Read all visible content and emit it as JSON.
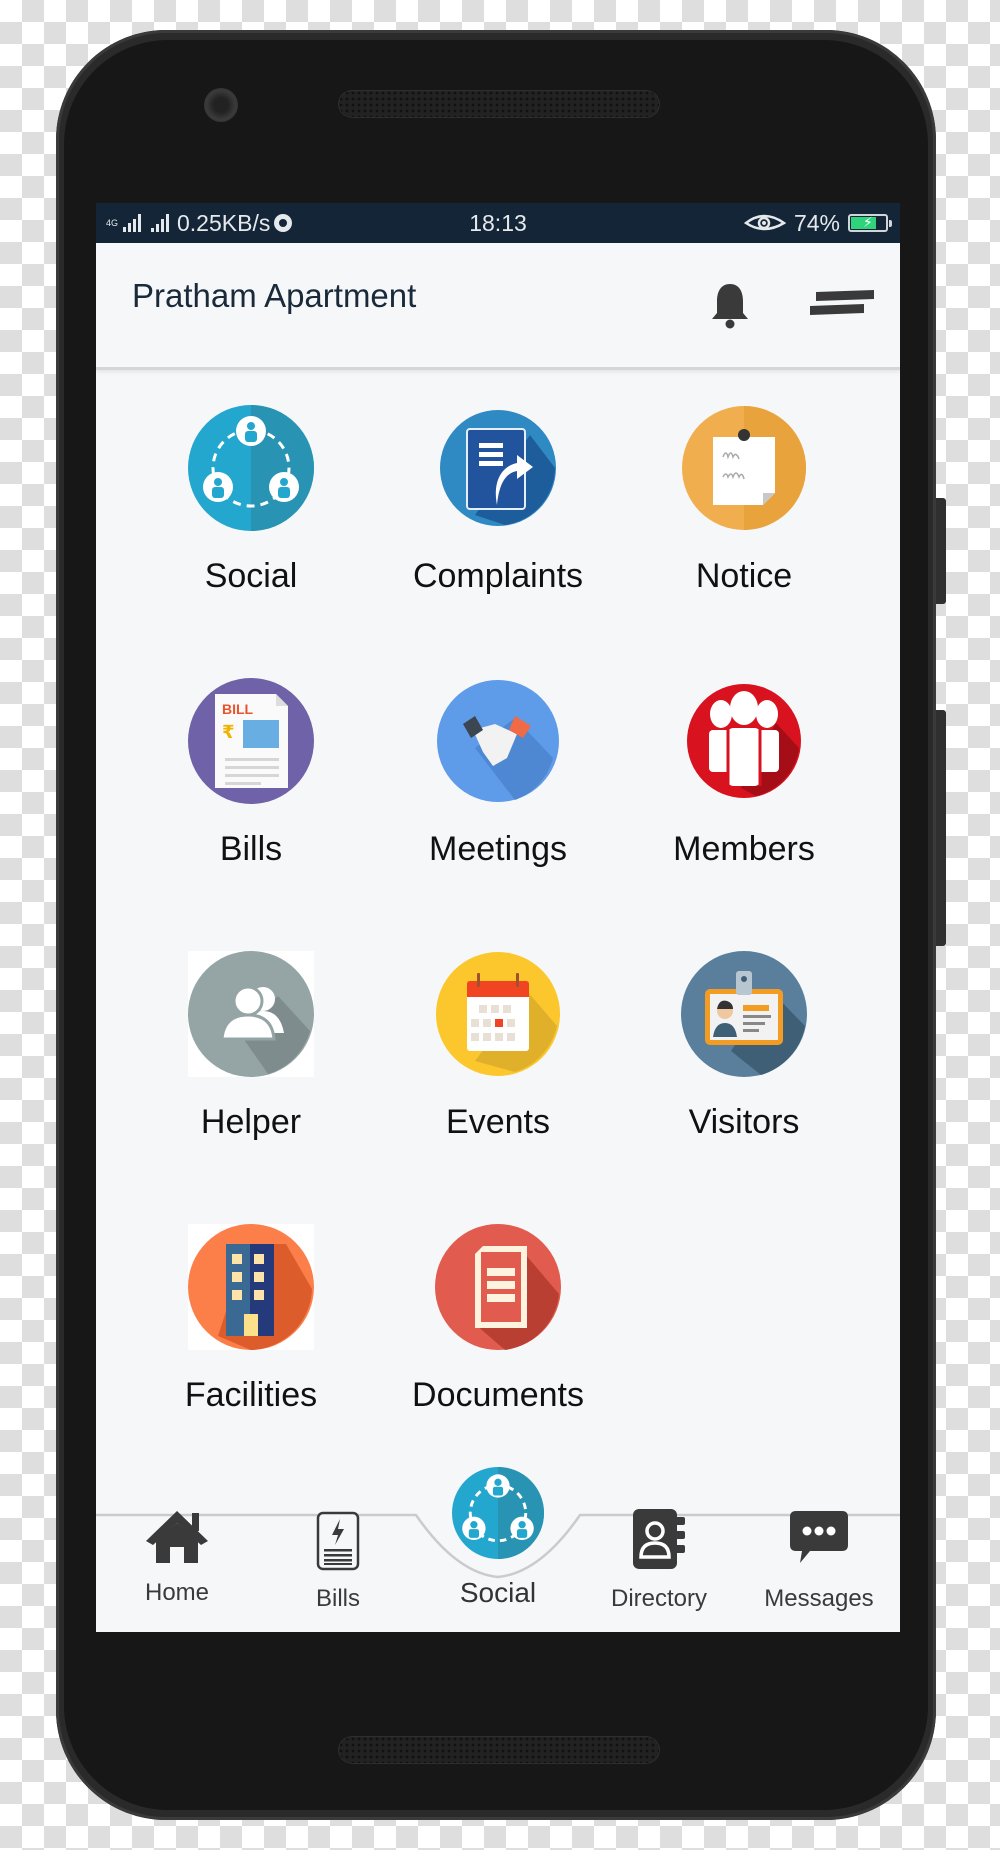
{
  "status_bar": {
    "network_type": "4G",
    "data_speed": "0.25KB/s",
    "time": "18:13",
    "battery_percent": "74%",
    "battery_level": 0.74,
    "icons": [
      "signal-icon",
      "signal-icon",
      "chrome-icon",
      "eye-icon",
      "battery-charging-icon"
    ]
  },
  "header": {
    "title": "Pratham Apartment",
    "icons": [
      "bell-icon",
      "menu-icon"
    ]
  },
  "grid": {
    "items": [
      {
        "label": "Social",
        "icon": "social-icon",
        "color": "#23a7cf"
      },
      {
        "label": "Complaints",
        "icon": "complaints-icon",
        "color": "#2f89c2"
      },
      {
        "label": "Notice",
        "icon": "notice-icon",
        "color": "#f0ad4e"
      },
      {
        "label": "Bills",
        "icon": "bills-icon",
        "color": "#6f62a8"
      },
      {
        "label": "Meetings",
        "icon": "meetings-icon",
        "color": "#5e9be8"
      },
      {
        "label": "Members",
        "icon": "members-icon",
        "color": "#d9121f"
      },
      {
        "label": "Helper",
        "icon": "helper-icon",
        "color": "#95a5a6"
      },
      {
        "label": "Events",
        "icon": "events-icon",
        "color": "#fbc72c"
      },
      {
        "label": "Visitors",
        "icon": "visitors-icon",
        "color": "#5a7f9c"
      },
      {
        "label": "Facilities",
        "icon": "facilities-icon",
        "color": "#fc7f4a"
      },
      {
        "label": "Documents",
        "icon": "documents-icon",
        "color": "#e15c4f"
      }
    ]
  },
  "bottom_nav": {
    "items": [
      {
        "label": "Home",
        "icon": "home-icon"
      },
      {
        "label": "Bills",
        "icon": "bill-phone-icon"
      },
      {
        "label": "Social",
        "icon": "social-icon",
        "active": true
      },
      {
        "label": "Directory",
        "icon": "directory-icon"
      },
      {
        "label": "Messages",
        "icon": "messages-icon"
      }
    ]
  }
}
